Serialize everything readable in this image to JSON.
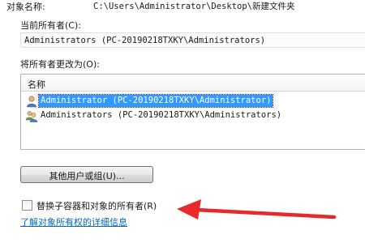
{
  "object": {
    "label": "对象名称:",
    "path": "C:\\Users\\Administrator\\Desktop\\新建文件夹"
  },
  "current_owner": {
    "label": "当前所有者(C):",
    "value": "Administrators (PC-20190218TXKY\\Administrators)"
  },
  "change_owner": {
    "label": "将所有者更改为(O):",
    "column_header": "名称",
    "items": [
      {
        "icon": "user-icon",
        "name": "Administrator (PC-20190218TXKY\\Administrator)",
        "selected": true
      },
      {
        "icon": "group-icon",
        "name": "Administrators (PC-20190218TXKY\\Administrators)",
        "selected": false
      }
    ]
  },
  "other_users_button": "其他用户或组(U)...",
  "replace_checkbox": {
    "label": "替换子容器和对象的所有者(R)",
    "checked": false
  },
  "learn_more_link": "了解对象所有权的详细信息",
  "annotation": {
    "icon": "red-arrow-icon",
    "color": "#e8282b"
  },
  "colors": {
    "selection": "#3399ff",
    "link": "#0066cc"
  }
}
